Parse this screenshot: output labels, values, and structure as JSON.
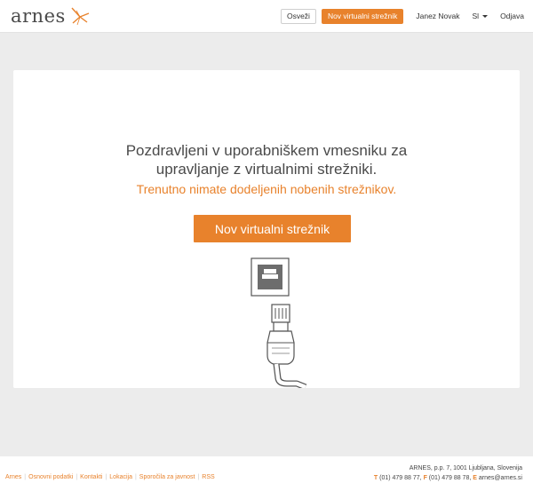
{
  "header": {
    "logo_text": "arnes",
    "refresh_label": "Osveži",
    "new_server_label": "Nov virtualni strežnik",
    "user_name": "Janez Novak",
    "language": "Sl",
    "logout_label": "Odjava"
  },
  "main": {
    "welcome_line1": "Pozdravljeni v uporabniškem vmesniku za",
    "welcome_line2": "upravljanje z virtualnimi strežniki.",
    "no_servers_text": "Trenutno nimate dodeljenih nobenih strežnikov.",
    "new_server_button": "Nov virtualni strežnik"
  },
  "footer": {
    "links": [
      "Arnes",
      "Osnovni podatki",
      "Kontakti",
      "Lokacija",
      "Sporočila za javnost",
      "RSS"
    ],
    "address": "ARNES, p.p. 7, 1001 Ljubljana, Slovenija",
    "phone_letter": "T",
    "phone": "(01) 479 88 77,",
    "fax_letter": "F",
    "fax": "(01) 479 88 78,",
    "email_letter": "E",
    "email": "arnes@arnes.si"
  },
  "colors": {
    "accent": "#e8822c",
    "background": "#ececec",
    "panel": "#ffffff"
  }
}
